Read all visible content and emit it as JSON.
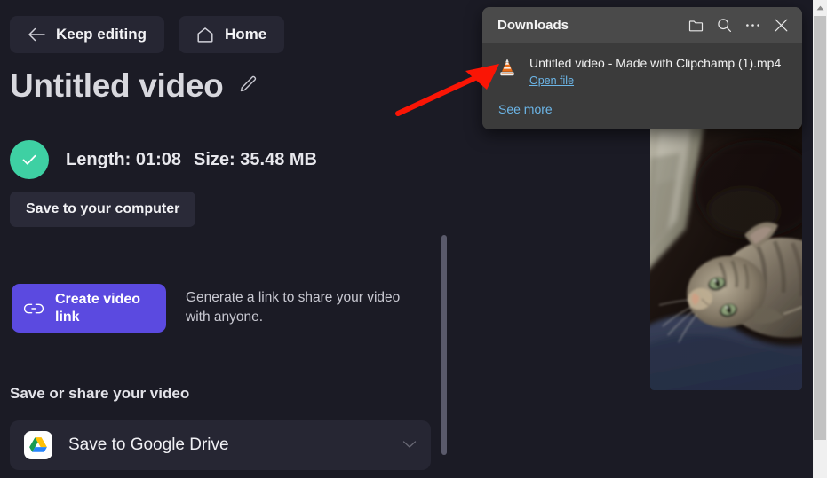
{
  "app": {
    "background_color": "#1b1b25",
    "accent_purple": "#5b4ae0",
    "success_green": "#3ed0a3",
    "link_blue": "#6cb6e8"
  },
  "topbar": {
    "keep_editing_label": "Keep editing",
    "keep_editing_icon": "arrow-left-icon",
    "home_label": "Home",
    "home_icon": "home-icon"
  },
  "header": {
    "title": "Untitled video",
    "edit_icon": "pencil-icon"
  },
  "status": {
    "check_icon": "check-circle-icon",
    "length_label": "Length: 01:08",
    "size_label": "Size: 35.48 MB",
    "save_to_computer_label": "Save to your computer"
  },
  "create_link": {
    "button_label_line1": "Create video",
    "button_label_line2": "link",
    "button_icon": "chain-link-icon",
    "description": "Generate a link to share your video with anyone."
  },
  "share": {
    "heading": "Save or share your video",
    "items": [
      {
        "label": "Save to Google Drive",
        "icon": "google-drive-icon",
        "chevron": "chevron-down-icon"
      }
    ]
  },
  "preview": {
    "alt": "cat-video-thumbnail"
  },
  "downloads": {
    "title": "Downloads",
    "header_buttons": [
      {
        "name": "open-folder-icon",
        "label": "Open downloads folder"
      },
      {
        "name": "search-icon",
        "label": "Search downloads"
      },
      {
        "name": "more-options-icon",
        "label": "More options"
      },
      {
        "name": "close-icon",
        "label": "Close"
      }
    ],
    "items": [
      {
        "filename": "Untitled video - Made with Clipchamp (1).mp4",
        "action_label": "Open file",
        "icon": "vlc-media-player-icon"
      }
    ],
    "see_more_label": "See more"
  },
  "scrollbars": {
    "inner_thumb": "panel-scrollbar-thumb",
    "browser_thumb": "browser-scrollbar-thumb",
    "browser_arrow": "scroll-up-arrow-icon"
  },
  "annotation": {
    "arrow": "red-pointer-arrow"
  }
}
